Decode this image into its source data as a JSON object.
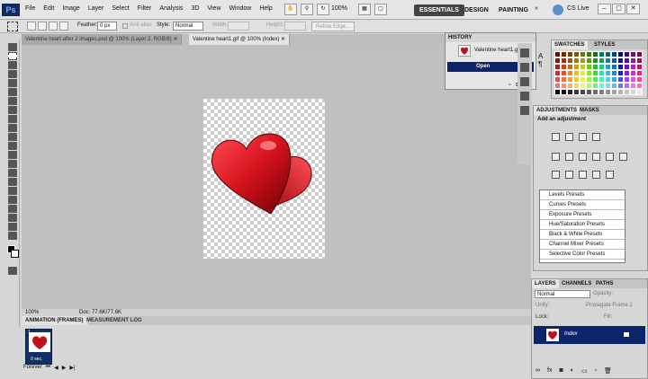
{
  "app": {
    "logo": "Ps"
  },
  "menu": [
    "File",
    "Edit",
    "Image",
    "Layer",
    "Select",
    "Filter",
    "Analysis",
    "3D",
    "View",
    "Window",
    "Help"
  ],
  "toolbar": {
    "zoom": "100%"
  },
  "workspace": {
    "essentials": "ESSENTIALS",
    "design": "DESIGN",
    "painting": "PAINTING",
    "more": "»",
    "cslive": "CS Live"
  },
  "options": {
    "feather_label": "Feather:",
    "feather_value": "0 px",
    "antialias": "Anti-alias",
    "style_label": "Style:",
    "style_value": "Normal",
    "width_label": "Width:",
    "height_label": "Height:",
    "refine": "Refine Edge..."
  },
  "tabs": [
    "Valentine heart after 2 images.psd @ 100% (Layer 2, RGB/8) ✕",
    "Valentine heart1.gif @ 100% (Index) ✕"
  ],
  "status": {
    "zoom": "100%",
    "doc": "Doc: 77.6K/77.6K"
  },
  "animation": {
    "tab1": "ANIMATION (FRAMES)",
    "tab2": "MEASUREMENT LOG",
    "frame_num": "1",
    "frame_time": "0 sec.",
    "loop": "Forever"
  },
  "history": {
    "title": "HISTORY",
    "snapshot": "Valentine heart1.gif",
    "step": "Open"
  },
  "swatches": {
    "tab1": "SWATCHES",
    "tab2": "STYLES"
  },
  "adjustments": {
    "tab1": "ADJUSTMENTS",
    "tab2": "MASKS",
    "title": "Add an adjustment",
    "presets": [
      "Levels Presets",
      "Curves Presets",
      "Exposure Presets",
      "Hue/Saturation Presets",
      "Black & White Presets",
      "Channel Mixer Presets",
      "Selective Color Presets"
    ]
  },
  "layers": {
    "tab1": "LAYERS",
    "tab2": "CHANNELS",
    "tab3": "PATHS",
    "blend": "Normal",
    "opacity": "Opacity:",
    "unify": "Unify:",
    "propagate": "Propagate Frame 1",
    "lock": "Lock:",
    "fill": "Fill:",
    "layer_name": "Index"
  },
  "colors": {
    "hist_sel": "#0b246a",
    "heart": "#d4121c"
  }
}
